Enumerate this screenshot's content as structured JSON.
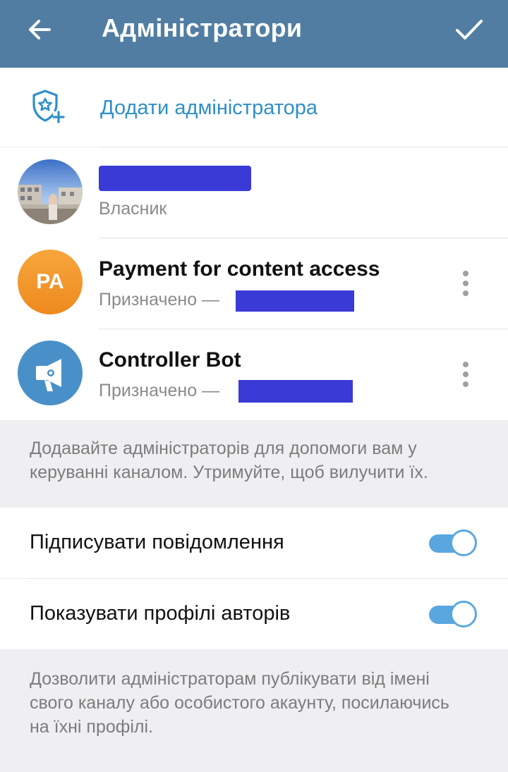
{
  "header": {
    "title": "Адміністратори",
    "back_icon": "arrow-left-icon",
    "confirm_icon": "checkmark-icon",
    "background": "#517da2"
  },
  "add_admin": {
    "label": "Додати адміністратора",
    "icon": "shield-star-plus-icon",
    "color": "#2f8fc8"
  },
  "admins": [
    {
      "name": "",
      "role": "Власник",
      "avatar": "photo"
    },
    {
      "name": "Payment for content access",
      "role": "Призначено —",
      "avatar_initials": "PA",
      "avatar_color": "#f39a2a"
    },
    {
      "name": "Controller Bot",
      "role": "Призначено —",
      "avatar": "megaphone-icon",
      "avatar_color": "#4a90c8"
    }
  ],
  "admins_note": "Додавайте адміністраторів для допомоги вам у керуванні каналом. Утримуйте, щоб вилучити їх.",
  "settings": [
    {
      "label": "Підписувати повідомлення",
      "enabled": true
    },
    {
      "label": "Показувати профілі авторів",
      "enabled": true
    }
  ],
  "settings_note": "Дозволити адміністраторам публікувати від імені свого каналу або особистого акаунту, посилаючись на їхні профілі.",
  "accent_color": "#5aa7e0"
}
